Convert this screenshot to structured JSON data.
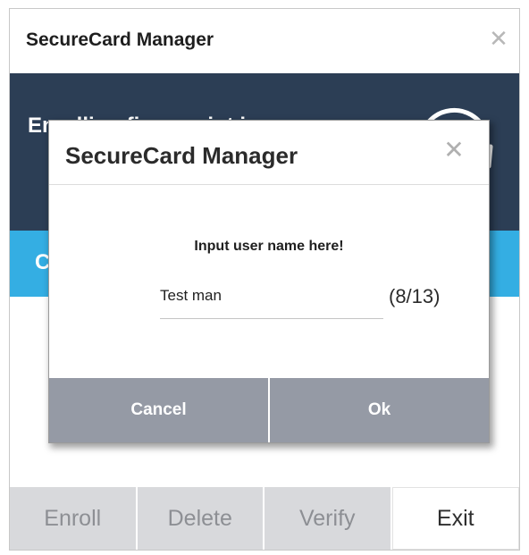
{
  "main_window": {
    "title": "SecureCard Manager",
    "close_glyph": "✕",
    "banner_text": "Enrolling fingerprint is",
    "status_text": "C",
    "footer_buttons": [
      "Enroll",
      "Delete",
      "Verify",
      "Exit"
    ]
  },
  "dialog": {
    "title": "SecureCard Manager",
    "close_glyph": "✕",
    "prompt": "Input user name here!",
    "input_value": "Test man",
    "char_count": "(8/13)",
    "cancel_label": "Cancel",
    "ok_label": "Ok"
  },
  "colors": {
    "banner": "#2c3e55",
    "status_bar": "#34aee3",
    "dialog_buttons": "#959aa5",
    "footer_disabled": "#d8d9dc"
  },
  "icons": {
    "close": "close-icon",
    "fingerprint": "fingerprint-icon"
  }
}
